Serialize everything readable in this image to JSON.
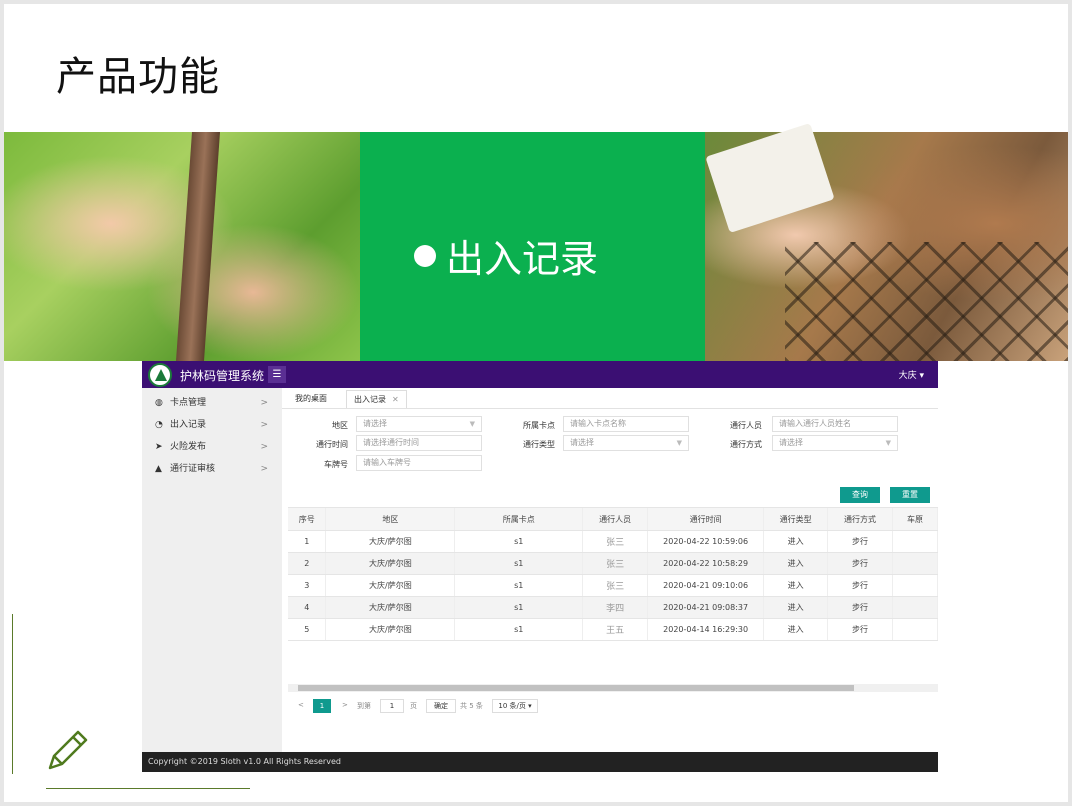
{
  "slide": {
    "title": "产品功能"
  },
  "banner": {
    "heading": "出入记录",
    "green": "#0bb04f"
  },
  "app": {
    "system_title": "护林码管理系统",
    "user_name": "大庆",
    "sidebar": [
      {
        "label": "卡点管理",
        "icon": "gauge-icon"
      },
      {
        "label": "出入记录",
        "icon": "record-icon"
      },
      {
        "label": "火险发布",
        "icon": "send-icon"
      },
      {
        "label": "通行证审核",
        "icon": "warning-icon"
      }
    ],
    "tabs": [
      {
        "label": "我的桌面"
      },
      {
        "label": "出入记录"
      }
    ],
    "filters": {
      "region_label": "地区",
      "region_value": "请选择",
      "checkpoint_label": "所属卡点",
      "checkpoint_placeholder": "请输入卡点名称",
      "person_label": "通行人员",
      "person_placeholder": "请输入通行人员姓名",
      "time_label": "通行时间",
      "time_placeholder": "请选择通行时间",
      "type_label": "通行类型",
      "type_value": "请选择",
      "method_label": "通行方式",
      "method_value": "请选择",
      "plate_label": "车牌号",
      "plate_placeholder": "请输入车牌号"
    },
    "buttons": {
      "query": "查询",
      "reset": "重置"
    },
    "table": {
      "headers": [
        "序号",
        "地区",
        "所属卡点",
        "通行人员",
        "通行时间",
        "通行类型",
        "通行方式",
        "车原"
      ],
      "rows": [
        [
          "1",
          "大庆/萨尔图",
          "s1",
          "张三",
          "2020-04-22 10:59:06",
          "进入",
          "步行",
          ""
        ],
        [
          "2",
          "大庆/萨尔图",
          "s1",
          "张三",
          "2020-04-22 10:58:29",
          "进入",
          "步行",
          ""
        ],
        [
          "3",
          "大庆/萨尔图",
          "s1",
          "张三",
          "2020-04-21 09:10:06",
          "进入",
          "步行",
          ""
        ],
        [
          "4",
          "大庆/萨尔图",
          "s1",
          "李四",
          "2020-04-21 09:08:37",
          "进入",
          "步行",
          ""
        ],
        [
          "5",
          "大庆/萨尔图",
          "s1",
          "王五",
          "2020-04-14 16:29:30",
          "进入",
          "步行",
          ""
        ]
      ]
    },
    "pager": {
      "prev": "<",
      "current": "1",
      "next": ">",
      "goto_label": "到第",
      "goto_value": "1",
      "page_unit": "页",
      "confirm": "确定",
      "total": "共 5 条",
      "page_size": "10 条/页"
    },
    "footer": "Copyright ©2019 Sloth v1.0 All Rights Reserved"
  }
}
